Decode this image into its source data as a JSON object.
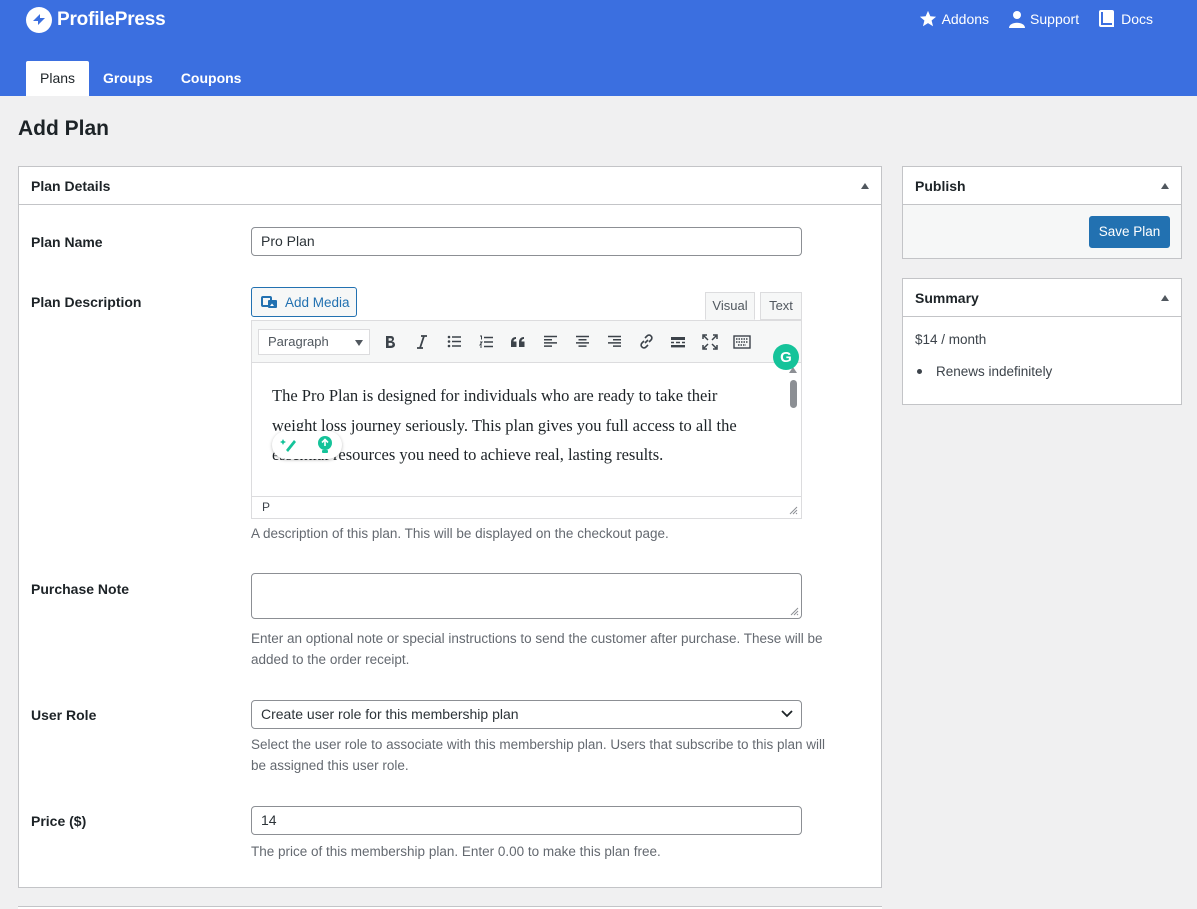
{
  "brand": {
    "name": "ProfilePress"
  },
  "top_links": [
    {
      "label": "Addons",
      "icon": "star-icon"
    },
    {
      "label": "Support",
      "icon": "person-icon"
    },
    {
      "label": "Docs",
      "icon": "book-icon"
    }
  ],
  "tabs": [
    {
      "label": "Plans",
      "active": true
    },
    {
      "label": "Groups",
      "active": false
    },
    {
      "label": "Coupons",
      "active": false
    }
  ],
  "page_title": "Add Plan",
  "plan_details": {
    "title": "Plan Details",
    "plan_name": {
      "label": "Plan Name",
      "value": "Pro Plan"
    },
    "plan_description": {
      "label": "Plan Description",
      "add_media": "Add Media",
      "tab_visual": "Visual",
      "tab_text": "Text",
      "format_select": "Paragraph",
      "content": "The Pro Plan is designed for individuals who are ready to take their weight loss journey seriously. This plan gives you full access to all the essential resources you need to achieve real, lasting results.",
      "status_path": "P",
      "grammarly_label": "G",
      "help": "A description of this plan. This will be displayed on the checkout page."
    },
    "purchase_note": {
      "label": "Purchase Note",
      "value": "",
      "help": "Enter an optional note or special instructions to send the customer after purchase. These will be added to the order receipt."
    },
    "user_role": {
      "label": "User Role",
      "selected": "Create user role for this membership plan",
      "help": "Select the user role to associate with this membership plan. Users that subscribe to this plan will be assigned this user role."
    },
    "price": {
      "label": "Price ($)",
      "value": "14",
      "help": "The price of this membership plan. Enter 0.00 to make this plan free."
    }
  },
  "publish": {
    "title": "Publish",
    "save_label": "Save Plan"
  },
  "summary": {
    "title": "Summary",
    "price_line": "$14 / month",
    "renewal": "Renews indefinitely"
  },
  "colors": {
    "header": "#3b6fe0",
    "primary_button": "#2271b1",
    "grammarly": "#15c39a"
  }
}
